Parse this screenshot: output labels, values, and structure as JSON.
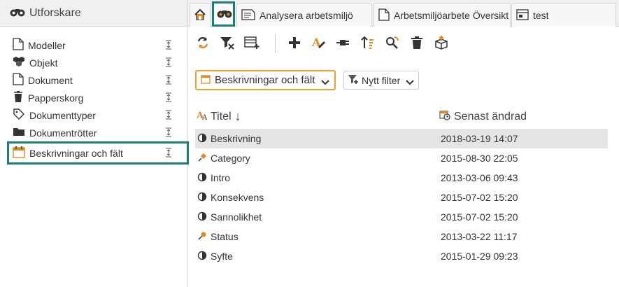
{
  "explorer": {
    "title": "Utforskare",
    "items": [
      {
        "label": "Modeller",
        "icon": "page-icon"
      },
      {
        "label": "Objekt",
        "icon": "cubes-icon"
      },
      {
        "label": "Dokument",
        "icon": "page-icon"
      },
      {
        "label": "Papperskorg",
        "icon": "trash-icon"
      },
      {
        "label": "Dokumenttyper",
        "icon": "tag-icon"
      },
      {
        "label": "Dokumentrötter",
        "icon": "folder-icon"
      },
      {
        "label": "Beskrivningar och fält",
        "icon": "calendar-icon"
      }
    ]
  },
  "tabs": [
    {
      "label": "",
      "icon": "home-icon"
    },
    {
      "label": "",
      "icon": "binoculars-icon"
    },
    {
      "label": "Analysera arbetsmiljö",
      "icon": "document-icon"
    },
    {
      "label": "Arbetsmiljöarbete Översikt",
      "icon": "document-icon"
    },
    {
      "label": "test",
      "icon": "form-icon"
    }
  ],
  "filter": {
    "selected": "Beskrivningar och fält",
    "new_filter": "Nytt filter"
  },
  "table": {
    "columns": [
      "Titel",
      "Senast ändrad"
    ],
    "sort_arrow": "↓",
    "rows": [
      {
        "title": "Beskrivning",
        "modified": "2018-03-19 14:07",
        "icon": "half-circle-icon"
      },
      {
        "title": "Category",
        "modified": "2015-08-30 22:05",
        "icon": "pushpin-icon"
      },
      {
        "title": "Intro",
        "modified": "2013-03-06 09:43",
        "icon": "half-circle-icon"
      },
      {
        "title": "Konsekvens",
        "modified": "2015-07-02 15:20",
        "icon": "half-circle-icon"
      },
      {
        "title": "Sannolikhet",
        "modified": "2015-07-02 15:20",
        "icon": "half-circle-icon"
      },
      {
        "title": "Status",
        "modified": "2013-03-22 11:17",
        "icon": "pin-icon"
      },
      {
        "title": "Syfte",
        "modified": "2015-01-29 09:23",
        "icon": "half-circle-icon"
      }
    ]
  },
  "colors": {
    "accent": "#1a7f7a",
    "highlight": "#f0a030",
    "selection": "#e5e5e5"
  }
}
